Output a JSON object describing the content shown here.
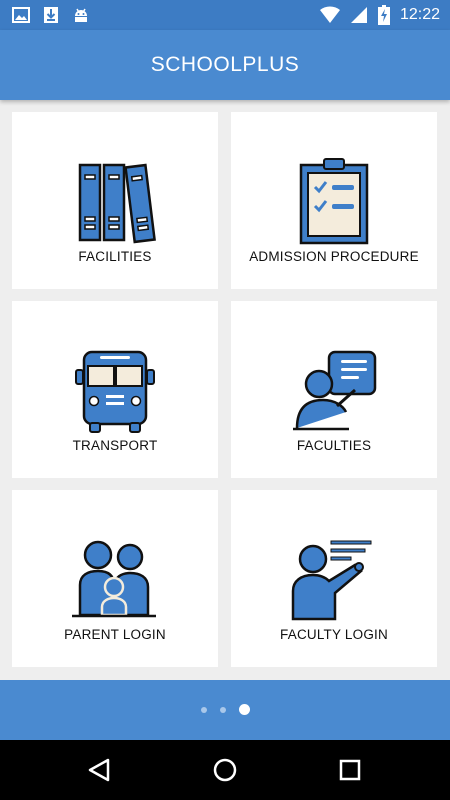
{
  "status_bar": {
    "time": "12:22",
    "left_icons": [
      "image-icon",
      "download-icon",
      "android-icon"
    ],
    "right_icons": [
      "wifi-icon",
      "signal-icon",
      "battery-charging-icon"
    ]
  },
  "app_bar": {
    "title": "SCHOOLPLUS"
  },
  "tiles": [
    {
      "label": "FACILITIES",
      "icon": "books-icon"
    },
    {
      "label": "ADMISSION PROCEDURE",
      "icon": "clipboard-checklist-icon"
    },
    {
      "label": "TRANSPORT",
      "icon": "bus-icon"
    },
    {
      "label": "FACULTIES",
      "icon": "teacher-speech-icon"
    },
    {
      "label": "PARENT LOGIN",
      "icon": "family-icon"
    },
    {
      "label": "FACULTY LOGIN",
      "icon": "lecturer-icon"
    }
  ],
  "pager": {
    "count": 3,
    "active_index": 2
  },
  "nav_bar": {
    "buttons": [
      "back-icon",
      "home-icon",
      "recents-icon"
    ]
  },
  "colors": {
    "status_bar": "#3d7cc4",
    "app_bar": "#4a8ad0",
    "icon_blue": "#3f7fc9",
    "icon_cream": "#f4ecdc",
    "background": "#eeeeee"
  }
}
